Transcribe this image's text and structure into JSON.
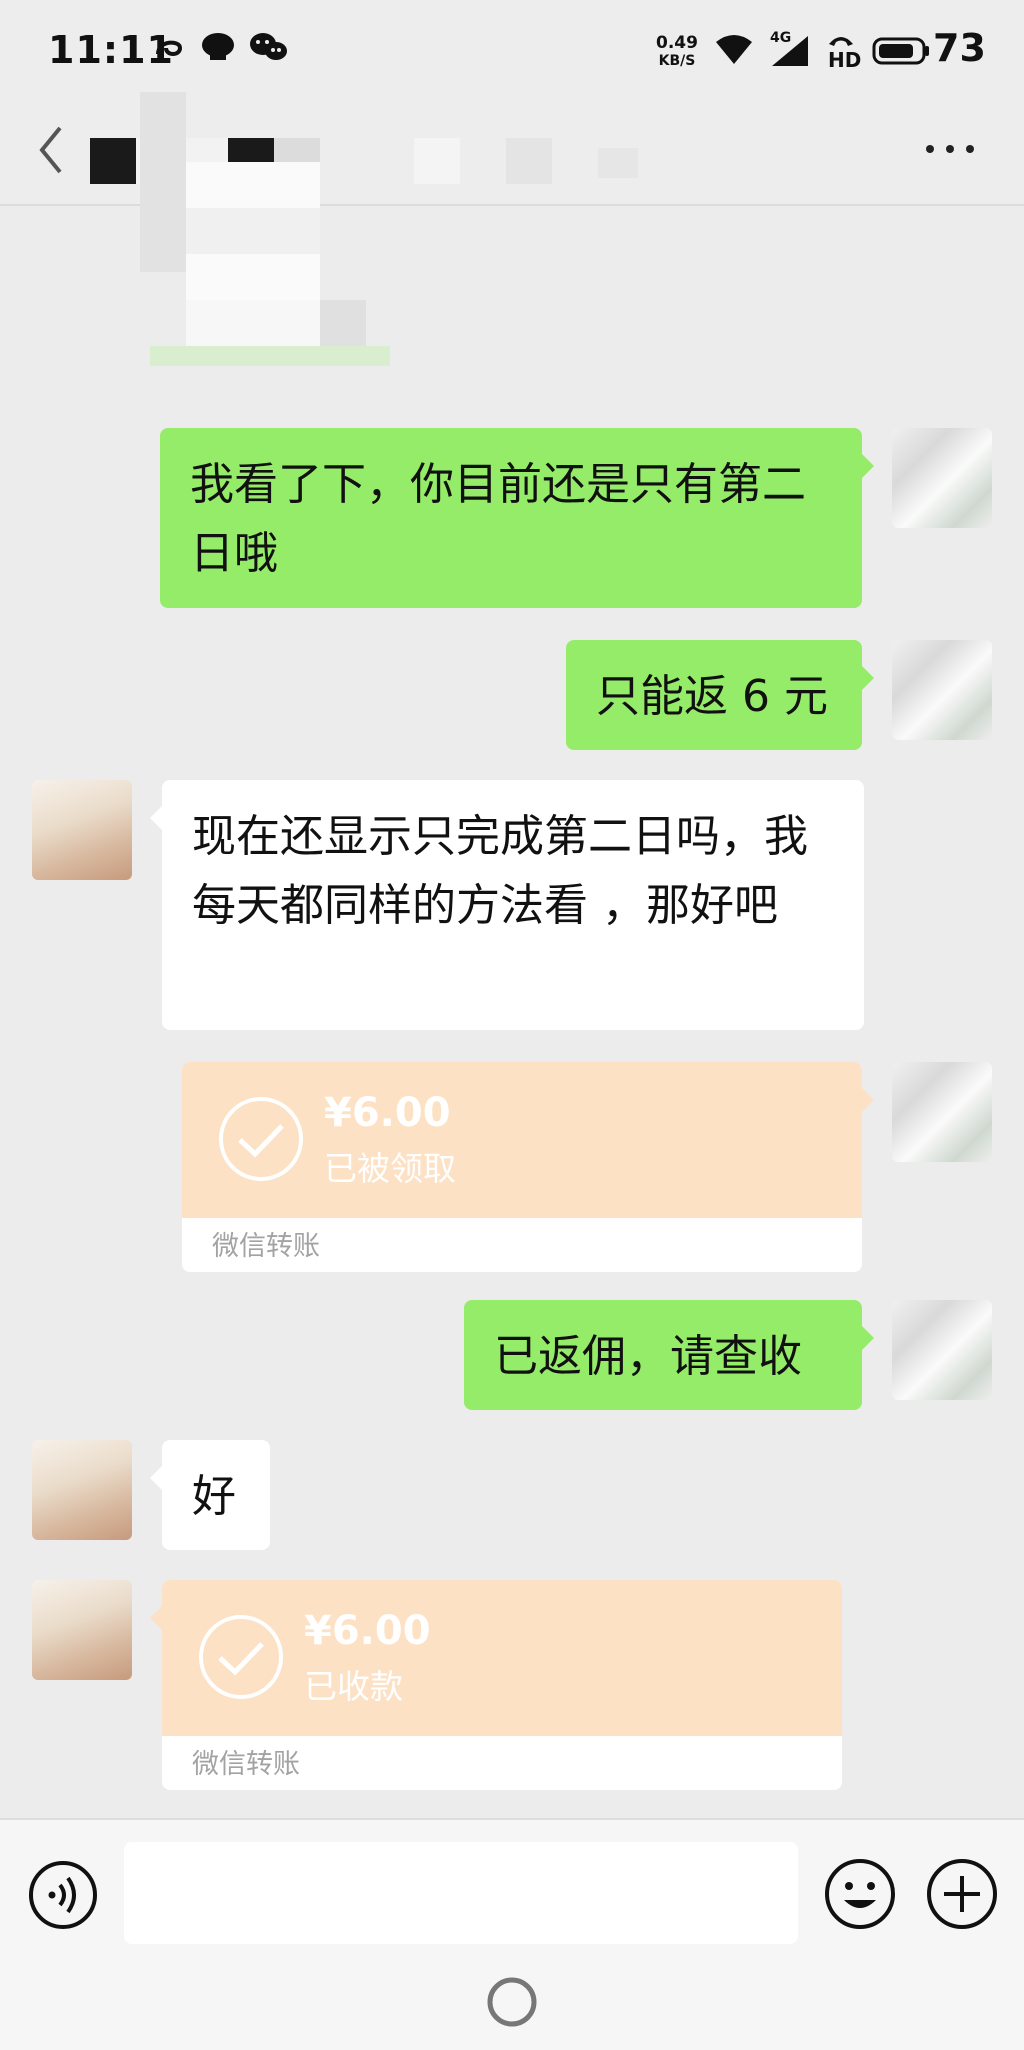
{
  "status_bar": {
    "time": "11:11",
    "speed_value": "0.49",
    "speed_unit": "KB/S",
    "network": "4G",
    "hd": "HD",
    "battery": "73"
  },
  "header": {
    "back_icon": "chevron-left-icon",
    "more_icon": "more-icon"
  },
  "messages": [
    {
      "sender": "me",
      "type": "text",
      "text": "我看了下，你目前还是只有第二日哦"
    },
    {
      "sender": "me",
      "type": "text",
      "text": "只能返 6 元"
    },
    {
      "sender": "other",
      "type": "text",
      "text": "现在还显示只完成第二日吗，我每天都同样的方法看 ，那好吧"
    },
    {
      "sender": "me",
      "type": "transfer",
      "amount": "¥6.00",
      "status": "已被领取",
      "label": "微信转账"
    },
    {
      "sender": "me",
      "type": "text",
      "text": "已返佣，请查收"
    },
    {
      "sender": "other",
      "type": "text",
      "text": "好"
    },
    {
      "sender": "other",
      "type": "transfer",
      "amount": "¥6.00",
      "status": "已收款",
      "label": "微信转账"
    }
  ],
  "colors": {
    "my_bubble": "#95ec69",
    "other_bubble": "#ffffff",
    "transfer_bg": "#fce1c5",
    "chat_bg": "#ececec"
  },
  "bottom_bar": {
    "voice_icon": "voice-icon",
    "emoji_icon": "emoji-icon",
    "plus_icon": "plus-icon",
    "home_icon": "home-indicator-icon"
  }
}
